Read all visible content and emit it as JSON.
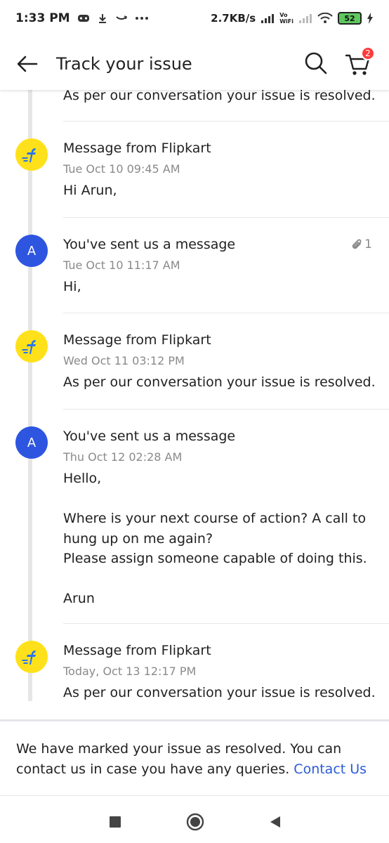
{
  "status_bar": {
    "time": "1:33 PM",
    "net_speed": "2.7KB/s",
    "vo_top": "Vo",
    "vo_bottom": "WiFi",
    "battery": "52",
    "left_icons": [
      "game-icon",
      "download-icon",
      "amazon-icon",
      "more-icon"
    ],
    "right_icons": [
      "signal-icon",
      "signal-icon",
      "wifi-icon",
      "charging-icon"
    ]
  },
  "header": {
    "title": "Track your issue",
    "cart_count": "2"
  },
  "timeline": {
    "partial_entry_body": "As per our conversation your issue is resolved.",
    "entries": [
      {
        "sender": "flipkart",
        "title": "Message from Flipkart",
        "time": "Tue Oct 10 09:45 AM",
        "body": "Hi Arun,"
      },
      {
        "sender": "user",
        "avatar_letter": "A",
        "title": "You've sent us a message",
        "time": "Tue Oct 10 11:17 AM",
        "body": "Hi,",
        "attachments": "1"
      },
      {
        "sender": "flipkart",
        "title": "Message from Flipkart",
        "time": "Wed Oct 11 03:12 PM",
        "body": "As per our conversation your issue is resolved."
      },
      {
        "sender": "user",
        "avatar_letter": "A",
        "title": "You've sent us a message",
        "time": "Thu Oct 12 02:28 AM",
        "body": "Hello,\n\nWhere is your next course of action? A call to hung up on me again?\nPlease assign someone capable of doing this.\n\nArun"
      },
      {
        "sender": "flipkart",
        "title": "Message from Flipkart",
        "time": "Today, Oct 13 12:17 PM",
        "body": "As per our conversation your issue is resolved."
      }
    ]
  },
  "footer": {
    "note": "We have marked your issue as resolved. You can contact us in case you have any queries.",
    "contact_link": "Contact Us"
  },
  "colors": {
    "flipkart_yellow": "#ffe11b",
    "flipkart_blue": "#2874f0",
    "user_avatar": "#2d55e0",
    "link": "#2a5bd7",
    "badge": "#ff3b3b"
  }
}
